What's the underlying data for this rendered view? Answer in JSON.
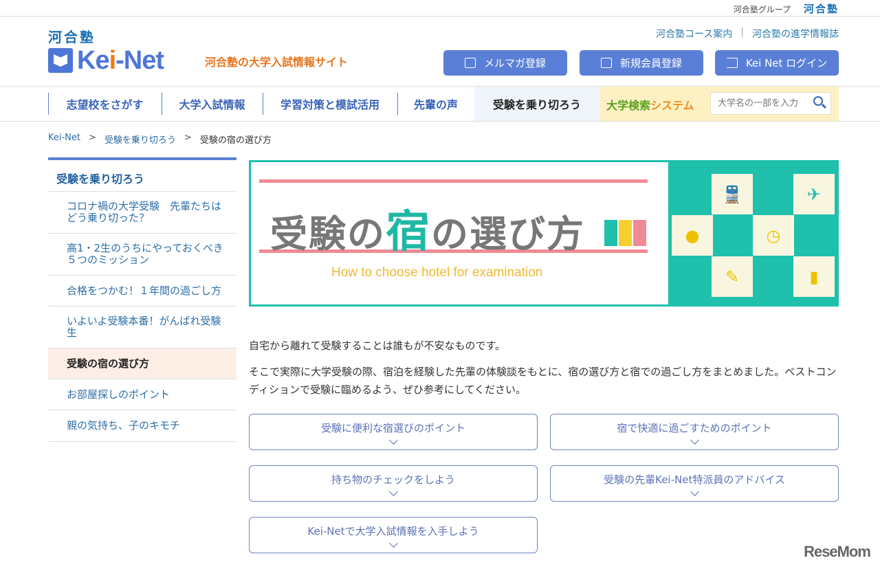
{
  "topbar": {
    "group_label": "河合塾グループ",
    "group_logo": "河合塾"
  },
  "header": {
    "kawai_logo": "河合塾",
    "keinet_logo": {
      "part1": "Ke",
      "part2": "i",
      "part3": "-Net"
    },
    "tagline": "河合塾の大学入試情報サイト",
    "links": [
      "河合塾コース案内",
      "河合塾の進学情報誌"
    ],
    "link_separator": "|",
    "buttons": [
      {
        "label": "メルマガ登録",
        "icon": "mail-icon"
      },
      {
        "label": "新規会員登録",
        "icon": "user-icon"
      },
      {
        "label": "Kei Net ログイン",
        "icon": "login-icon"
      }
    ]
  },
  "nav": {
    "items": [
      "志望校をさがす",
      "大学入試情報",
      "学習対策と模試活用",
      "先輩の声",
      "受験を乗り切ろう"
    ],
    "search_title": {
      "a": "大学検索",
      "b": "システム"
    },
    "search_placeholder": "大学名の一部を入力"
  },
  "breadcrumb": {
    "items": [
      "Kei-Net",
      "受験を乗り切ろう",
      "受験の宿の選び方"
    ],
    "separator": ">"
  },
  "sidebar": {
    "heading": "受験を乗り切ろう",
    "items": [
      "コロナ禍の大学受験　先輩たちはどう乗り切った？",
      "高1・2生のうちにやっておくべき５つのミッション",
      "合格をつかむ！１年間の過ごし方",
      "いよいよ受験本番！がんばれ受験生",
      "受験の宿の選び方",
      "お部屋探しのポイント",
      "親の気持ち、子のキモチ"
    ],
    "active_index": 4
  },
  "banner": {
    "title_a": "受験の",
    "title_b": "宿",
    "title_c": "の選び方",
    "subtitle": "How to choose hotel for examination"
  },
  "intro": {
    "p1": "自宅から離れて受験することは誰もが不安なものです。",
    "p2": "そこで実際に大学受験の際、宿泊を経験した先輩の体験談をもとに、宿の選び方と宿での過ごし方をまとめました。ベストコンディションで受験に臨めるよう、ぜひ参考にしてください。"
  },
  "sections": [
    "受験に便利な宿選びのポイント",
    "宿で快適に過ごすためのポイント",
    "持ち物のチェックをしよう",
    "受験の先輩Kei-Net特派員のアドバイス",
    "Kei-Netで大学入試情報を入手しよう"
  ],
  "watermark": "ReseMom",
  "colors": {
    "brand_blue": "#5a7fd6",
    "accent_orange": "#e8731a",
    "banner_teal": "#1fc0ac"
  }
}
